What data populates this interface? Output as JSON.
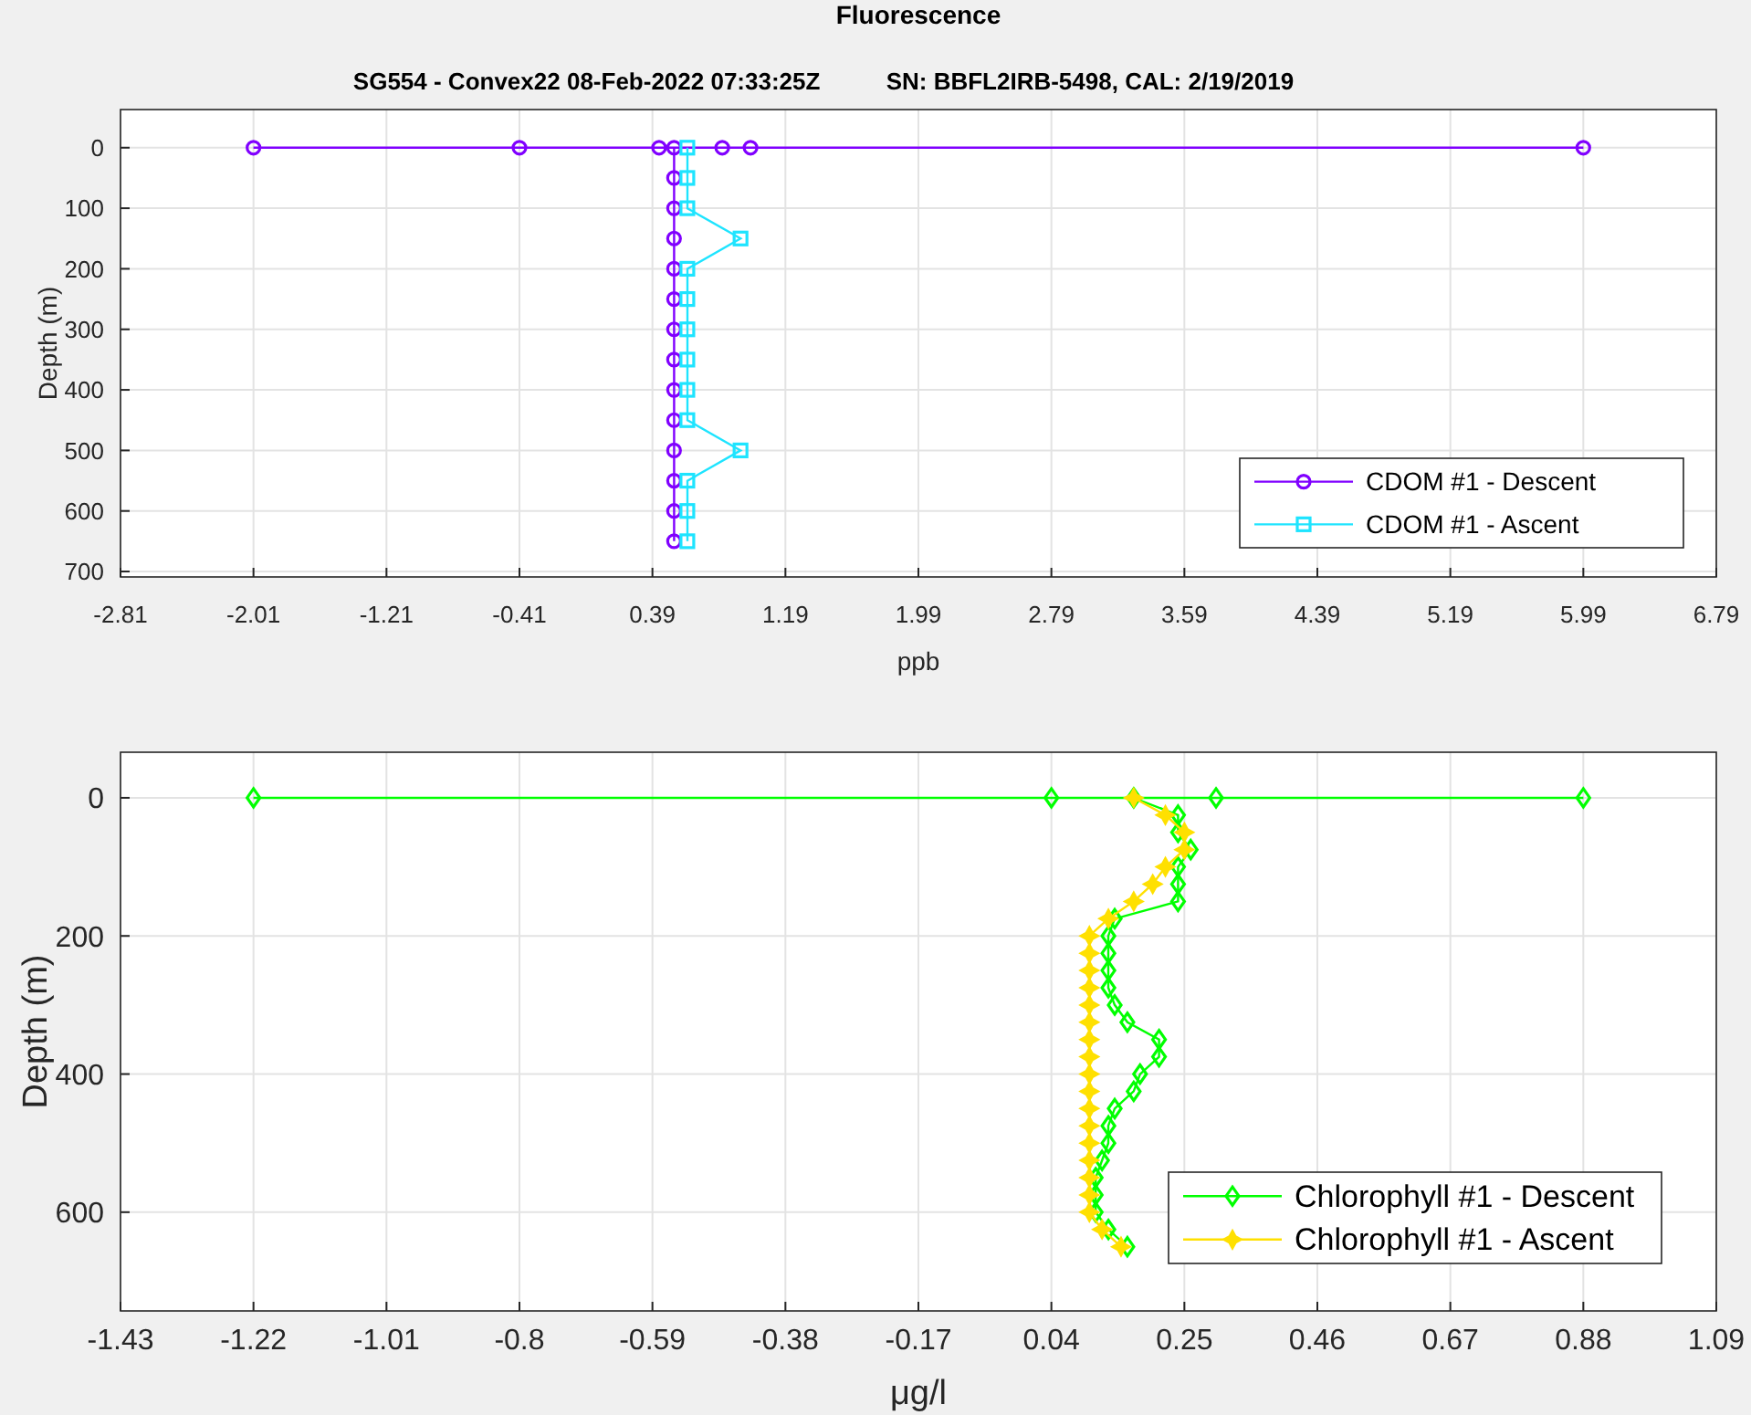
{
  "figure": {
    "title": "Fluorescence"
  },
  "plots": [
    {
      "chart_data": {
        "type": "line",
        "title": "SG554 - Convex22 08-Feb-2022 07:33:25Z          SN: BBFL2IRB-5498, CAL: 2/19/2019",
        "xlabel": "ppb",
        "ylabel": "Depth (m)",
        "grid": true,
        "legend": true,
        "series": [
          {
            "name": "CDOM #1 - Descent",
            "color": "#8000ff",
            "marker": "circle",
            "x": [
              -2.01,
              -0.41,
              5.99,
              0.98,
              0.81,
              0.43,
              0.52,
              0.52,
              0.52,
              0.52,
              0.52,
              0.52,
              0.52,
              0.52,
              0.52,
              0.52,
              0.52,
              0.52,
              0.52,
              0.52
            ],
            "values": [
              0,
              0,
              0,
              0,
              0,
              0,
              0,
              50,
              100,
              150,
              200,
              250,
              300,
              350,
              400,
              450,
              500,
              550,
              600,
              650
            ]
          },
          {
            "name": "CDOM #1 - Ascent",
            "color": "#1ee4ff",
            "marker": "square",
            "x": [
              0.6,
              0.6,
              0.6,
              0.92,
              0.6,
              0.6,
              0.6,
              0.6,
              0.6,
              0.6,
              0.92,
              0.6,
              0.6,
              0.6
            ],
            "values": [
              0,
              50,
              100,
              150,
              200,
              250,
              300,
              350,
              400,
              450,
              500,
              550,
              600,
              650
            ]
          }
        ],
        "xlim": [
          -2.81,
          6.79
        ],
        "ylim": [
          709,
          -63
        ],
        "xticks": [
          -2.81,
          -2.01,
          -1.21,
          -0.41,
          0.39,
          1.19,
          1.99,
          2.79,
          3.59,
          4.39,
          5.19,
          5.99,
          6.79
        ],
        "yticks": [
          0,
          100,
          200,
          300,
          400,
          500,
          600,
          700
        ]
      }
    },
    {
      "chart_data": {
        "type": "line",
        "xlabel": "μg/l",
        "ylabel": "Depth (m)",
        "grid": true,
        "legend": true,
        "series": [
          {
            "name": "Chlorophyll #1 - Descent",
            "color": "#00ff00",
            "marker": "diamond",
            "x": [
              -1.22,
              0.04,
              0.88,
              0.3,
              0.17,
              0.24,
              0.24,
              0.26,
              0.24,
              0.24,
              0.24,
              0.14,
              0.13,
              0.13,
              0.13,
              0.13,
              0.14,
              0.16,
              0.21,
              0.21,
              0.18,
              0.17,
              0.14,
              0.13,
              0.13,
              0.12,
              0.11,
              0.11,
              0.11,
              0.13,
              0.16
            ],
            "values": [
              0,
              0,
              0,
              0,
              0,
              25,
              50,
              75,
              100,
              125,
              150,
              175,
              200,
              225,
              250,
              275,
              300,
              325,
              350,
              375,
              400,
              425,
              450,
              475,
              500,
              525,
              550,
              575,
              600,
              625,
              650
            ]
          },
          {
            "name": "Chlorophyll #1 - Ascent",
            "color": "#ffe000",
            "marker": "star",
            "x": [
              0.17,
              0.22,
              0.25,
              0.25,
              0.22,
              0.2,
              0.17,
              0.13,
              0.1,
              0.1,
              0.1,
              0.1,
              0.1,
              0.1,
              0.1,
              0.1,
              0.1,
              0.1,
              0.1,
              0.1,
              0.1,
              0.1,
              0.1,
              0.1,
              0.1,
              0.12,
              0.15
            ],
            "values": [
              0,
              25,
              50,
              75,
              100,
              125,
              150,
              175,
              200,
              225,
              250,
              275,
              300,
              325,
              350,
              375,
              400,
              425,
              450,
              475,
              500,
              525,
              550,
              575,
              600,
              625,
              650
            ]
          }
        ],
        "xlim": [
          -1.43,
          1.09
        ],
        "ylim": [
          743,
          -66
        ],
        "xticks": [
          -1.43,
          -1.22,
          -1.01,
          -0.8,
          -0.59,
          -0.38,
          -0.17,
          0.04,
          0.25,
          0.46,
          0.67,
          0.88,
          1.09
        ],
        "yticks": [
          0,
          200,
          400,
          600
        ]
      }
    }
  ]
}
